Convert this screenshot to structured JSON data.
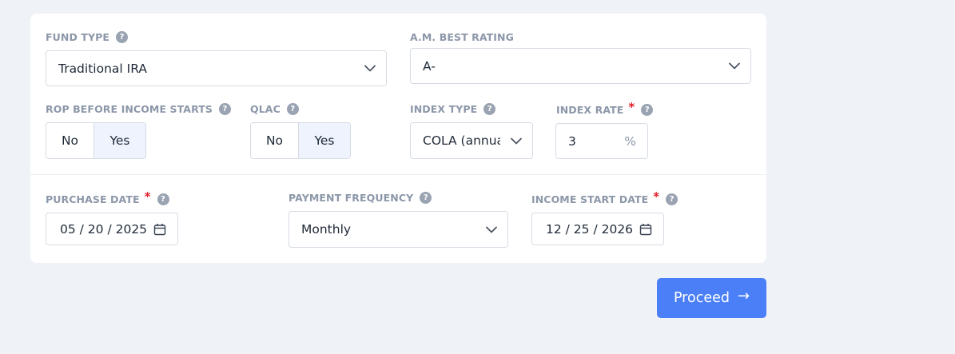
{
  "form": {
    "fund_type": {
      "label": "FUND TYPE",
      "help": "?",
      "value": "Traditional IRA"
    },
    "am_best_rating": {
      "label": "A.M. BEST RATING",
      "value": "A-"
    },
    "rop": {
      "label": "ROP BEFORE INCOME STARTS",
      "help": "?",
      "options": [
        "No",
        "Yes"
      ],
      "selected": "Yes"
    },
    "qlac": {
      "label": "QLAC",
      "help": "?",
      "options": [
        "No",
        "Yes"
      ],
      "selected": "Yes"
    },
    "index_type": {
      "label": "INDEX TYPE",
      "help": "?",
      "value": "COLA (annual)"
    },
    "index_rate": {
      "label": "INDEX RATE",
      "required": "*",
      "help": "?",
      "value": "3",
      "suffix": "%"
    },
    "purchase_date": {
      "label": "PURCHASE DATE",
      "required": "*",
      "help": "?",
      "value": "05 / 20 / 2025"
    },
    "payment_frequency": {
      "label": "PAYMENT FREQUENCY",
      "help": "?",
      "value": "Monthly"
    },
    "income_start_date": {
      "label": "INCOME START DATE",
      "required": "*",
      "help": "?",
      "value": "12 / 25 / 2026"
    }
  },
  "actions": {
    "proceed_label": "Proceed",
    "proceed_icon": "arrow-right-icon",
    "arrow_glyph": "→"
  },
  "colors": {
    "background": "#eff2f7",
    "card": "#ffffff",
    "accent": "#4a7ff7",
    "required": "#e11d2a",
    "label": "#8c97a9",
    "toggle_selected": "#eef3fd"
  }
}
